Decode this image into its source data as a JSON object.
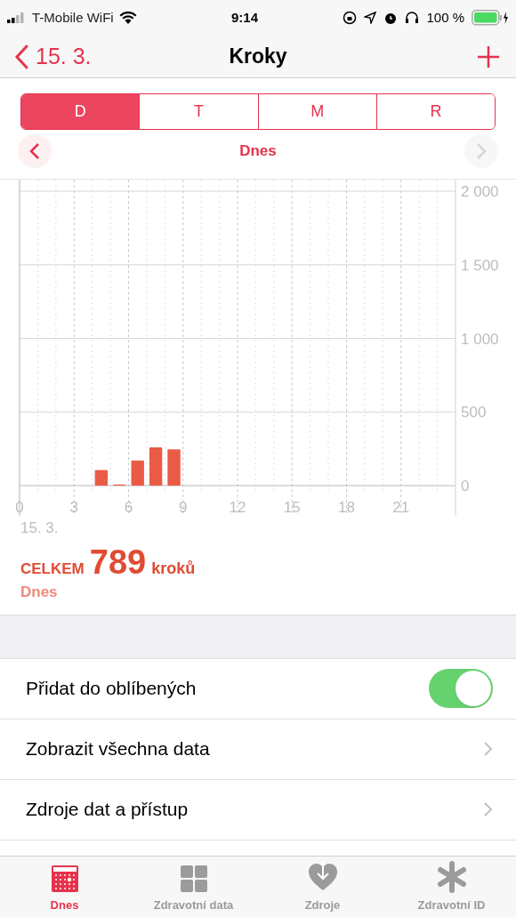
{
  "status_bar": {
    "carrier": "T-Mobile WiFi",
    "time": "9:14",
    "battery": "100 %"
  },
  "nav": {
    "back": "15. 3.",
    "title": "Kroky"
  },
  "segments": [
    {
      "label": "D",
      "selected": true
    },
    {
      "label": "T",
      "selected": false
    },
    {
      "label": "M",
      "selected": false
    },
    {
      "label": "R",
      "selected": false
    }
  ],
  "period": {
    "label": "Dnes",
    "prev_disabled": false,
    "next_disabled": true
  },
  "chart_data": {
    "type": "bar",
    "grid": true,
    "xlim": [
      0,
      24
    ],
    "x": [
      4.5,
      5.5,
      6.5,
      7.5,
      8.5
    ],
    "values": [
      105,
      8,
      170,
      260,
      246
    ],
    "xticks": [
      {
        "value": 0,
        "label": "0"
      },
      {
        "value": 3,
        "label": "3"
      },
      {
        "value": 6,
        "label": "6"
      },
      {
        "value": 9,
        "label": "9"
      },
      {
        "value": 12,
        "label": "12"
      },
      {
        "value": 15,
        "label": "15"
      },
      {
        "value": 18,
        "label": "18"
      },
      {
        "value": 21,
        "label": "21"
      }
    ],
    "ylim": [
      0,
      2000
    ],
    "yticks": [
      {
        "value": 0,
        "label": "0"
      },
      {
        "value": 500,
        "label": "500"
      },
      {
        "value": 1000,
        "label": "1 000"
      },
      {
        "value": 1500,
        "label": "1 500"
      },
      {
        "value": 2000,
        "label": "2 000"
      }
    ]
  },
  "chart_date": "15. 3.",
  "summary": {
    "label": "CELKEM",
    "value": "789",
    "unit": "kroků",
    "period": "Dnes"
  },
  "rows": [
    {
      "kind": "toggle",
      "label": "Přidat do oblíbených",
      "on": true
    },
    {
      "kind": "link",
      "label": "Zobrazit všechna data"
    },
    {
      "kind": "link",
      "label": "Zdroje dat a přístup"
    }
  ],
  "tab_bar": [
    {
      "label": "Dnes",
      "selected": true
    },
    {
      "label": "Zdravotní data",
      "selected": false
    },
    {
      "label": "Zdroje",
      "selected": false
    },
    {
      "label": "Zdravotní ID",
      "selected": false
    }
  ]
}
